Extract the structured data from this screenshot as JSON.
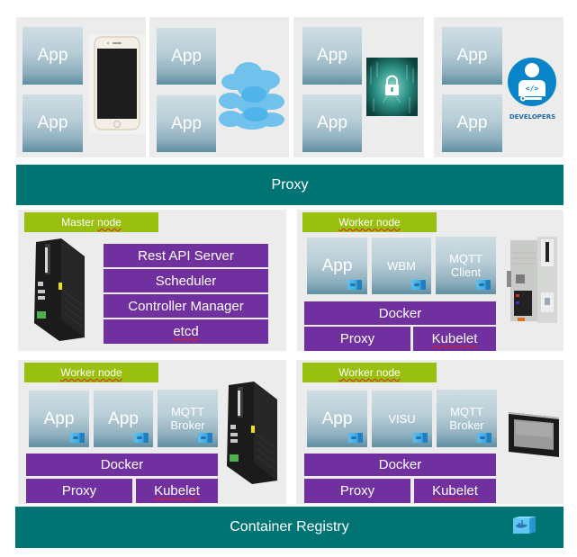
{
  "diagram": {
    "top_clients": [
      {
        "apps": [
          "App",
          "App"
        ],
        "device_icon": "smartphone"
      },
      {
        "apps": [
          "App",
          "App"
        ],
        "device_icon": "cloud"
      },
      {
        "apps": [
          "App",
          "App"
        ],
        "device_icon": "security-lock"
      },
      {
        "apps": [
          "App",
          "App"
        ],
        "device_icon": "developers",
        "device_caption": "DEVELOPERS"
      }
    ],
    "proxy_bar": "Proxy",
    "master_node": {
      "label": "Master node",
      "device_icon": "industrial-pc",
      "components": [
        "Rest API Server",
        "Scheduler",
        "Controller Manager",
        "etcd"
      ]
    },
    "worker_nodes": [
      {
        "label": "Worker node",
        "device_icon": "plc-controller",
        "containers": [
          "App",
          "WBM",
          "MQTT Client"
        ],
        "runtime": "Docker",
        "agents": [
          "Proxy",
          "Kubelet"
        ]
      },
      {
        "label": "Worker node",
        "device_icon": "industrial-pc",
        "containers": [
          "App",
          "App",
          "MQTT Broker"
        ],
        "runtime": "Docker",
        "agents": [
          "Proxy",
          "Kubelet"
        ]
      },
      {
        "label": "Worker node",
        "device_icon": "touch-panel",
        "containers": [
          "App",
          "VISU",
          "MQTT Broker"
        ],
        "runtime": "Docker",
        "agents": [
          "Proxy",
          "Kubelet"
        ]
      }
    ],
    "registry_bar": "Container Registry",
    "registry_icon": "docker-container",
    "colors": {
      "teal_bar": "#007373",
      "purple_block": "#7030a0",
      "green_label": "#99c00f",
      "panel_bg": "#ececec",
      "developer_blue": "#0a84c8"
    }
  }
}
